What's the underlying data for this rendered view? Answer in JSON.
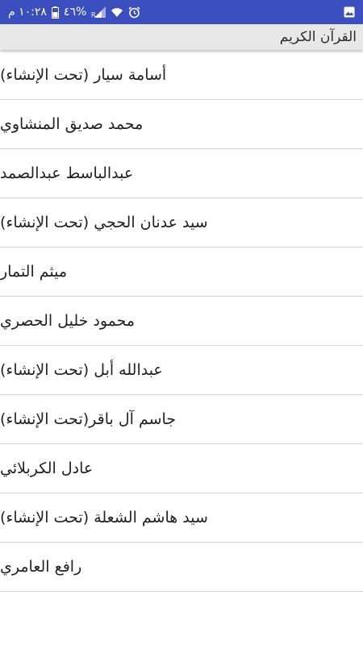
{
  "status_bar": {
    "time": "١٠:٢٨ م",
    "battery_percent": "٤٦%",
    "icons": [
      "battery-icon",
      "signal-icon",
      "wifi-icon",
      "alarm-icon",
      "gallery-notification-icon"
    ]
  },
  "app_bar": {
    "title": "القرآن الكريم"
  },
  "reciters": [
    {
      "label": "أسامة سيار (تحت الإنشاء)"
    },
    {
      "label": "محمد صديق المنشاوي"
    },
    {
      "label": "عبدالباسط عبدالصمد"
    },
    {
      "label": "سيد عدنان الحجي (تحت الإنشاء)"
    },
    {
      "label": "ميثم التمار"
    },
    {
      "label": "محمود خليل الحصري"
    },
    {
      "label": "عبدالله أبل (تحت الإنشاء)"
    },
    {
      "label": "جاسم آل باقر(تحت الإنشاء)"
    },
    {
      "label": "عادل الكربلائي"
    },
    {
      "label": "سيد هاشم الشعلة (تحت الإنشاء)"
    },
    {
      "label": "رافع العامري"
    }
  ],
  "colors": {
    "status_bar": "#3a4fbd",
    "app_bar": "#e8e8e8",
    "divider": "#d6d6d6"
  }
}
